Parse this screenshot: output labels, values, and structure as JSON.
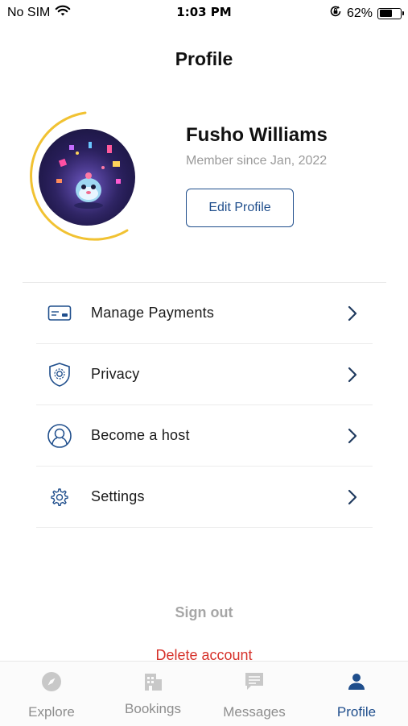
{
  "status_bar": {
    "carrier": "No SIM",
    "time": "1:03 PM",
    "battery_percent": "62%",
    "battery_level": 0.62
  },
  "page_title": "Profile",
  "profile": {
    "name": "Fusho Williams",
    "member_since": "Member since Jan, 2022",
    "edit_label": "Edit Profile"
  },
  "menu": [
    {
      "label": "Manage Payments",
      "icon": "card-icon"
    },
    {
      "label": "Privacy",
      "icon": "shield-icon"
    },
    {
      "label": "Become a host",
      "icon": "user-circle-icon"
    },
    {
      "label": "Settings",
      "icon": "gear-icon"
    }
  ],
  "actions": {
    "sign_out": "Sign out",
    "delete_account": "Delete account"
  },
  "tabs": [
    {
      "label": "Explore",
      "icon": "compass-icon",
      "active": false
    },
    {
      "label": "Bookings",
      "icon": "building-icon",
      "active": false
    },
    {
      "label": "Messages",
      "icon": "message-icon",
      "active": false
    },
    {
      "label": "Profile",
      "icon": "person-icon",
      "active": true
    }
  ],
  "colors": {
    "accent": "#1f4e8c",
    "ring": "#f1c232",
    "danger": "#d6322b",
    "muted": "#a6a6a6"
  }
}
